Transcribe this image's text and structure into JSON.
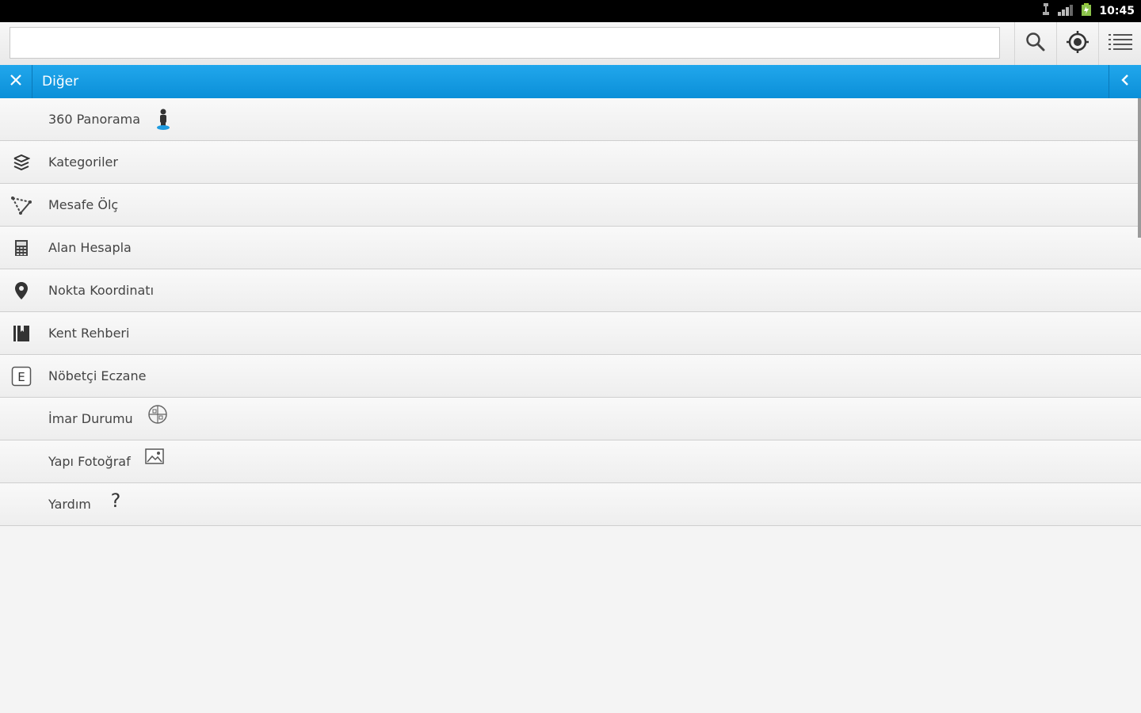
{
  "status_bar": {
    "time": "10:45"
  },
  "toolbar": {
    "search_value": "",
    "search_placeholder": ""
  },
  "header": {
    "title": "Diğer"
  },
  "menu": {
    "items": [
      {
        "label": "360 Panorama",
        "icon": "street-view-icon"
      },
      {
        "label": "Kategoriler",
        "icon": "layers-icon"
      },
      {
        "label": "Mesafe Ölç",
        "icon": "ruler-icon"
      },
      {
        "label": "Alan Hesapla",
        "icon": "calculator-icon"
      },
      {
        "label": "Nokta Koordinatı",
        "icon": "map-pin-icon"
      },
      {
        "label": "Kent Rehberi",
        "icon": "book-icon"
      },
      {
        "label": "Nöbetçi Eczane",
        "icon": "pharmacy-e-icon"
      },
      {
        "label": "İmar Durumu",
        "icon": "zoning-icon"
      },
      {
        "label": "Yapı Fotoğraf",
        "icon": "photo-icon"
      },
      {
        "label": "Yardım",
        "icon": "help-icon"
      }
    ]
  },
  "colors": {
    "header": "#0b8fd8",
    "accent": "#1e9be0",
    "text": "#444444"
  }
}
